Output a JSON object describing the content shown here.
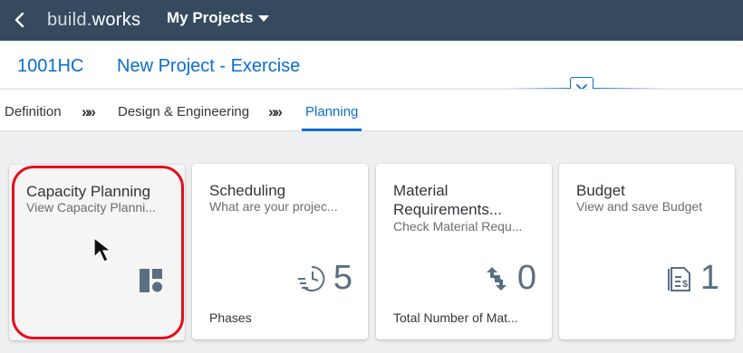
{
  "shell": {
    "brand_light": "build",
    "brand_dot": ".",
    "brand_bold": "works",
    "menu_label": "My Projects"
  },
  "object": {
    "id": "1001HC",
    "name": "New Project - Exercise"
  },
  "steps": [
    {
      "label": "Definition",
      "active": false
    },
    {
      "label": "Design & Engineering",
      "active": false
    },
    {
      "label": "Planning",
      "active": true
    }
  ],
  "step_separator": "»»",
  "tiles": [
    {
      "title": "Capacity Planning",
      "subtitle": "View Capacity Planni...",
      "icon": "capacity-layout-icon",
      "footer": "",
      "value": ""
    },
    {
      "title": "Scheduling",
      "subtitle": "What are your projec...",
      "icon": "schedule-clock-icon",
      "footer": "Phases",
      "value": "5"
    },
    {
      "title": "Material Requirements...",
      "subtitle": "Check Material Requ...",
      "icon": "material-transfer-icon",
      "footer": "Total Number of Mat...",
      "value": "0"
    },
    {
      "title": "Budget",
      "subtitle": "View and save Budget",
      "icon": "budget-document-icon",
      "footer": "",
      "value": "1"
    }
  ],
  "colors": {
    "shell": "#354a5f",
    "accent": "#0a6ed1",
    "highlight": "#e3101b",
    "kpi": "#5a6f84"
  }
}
